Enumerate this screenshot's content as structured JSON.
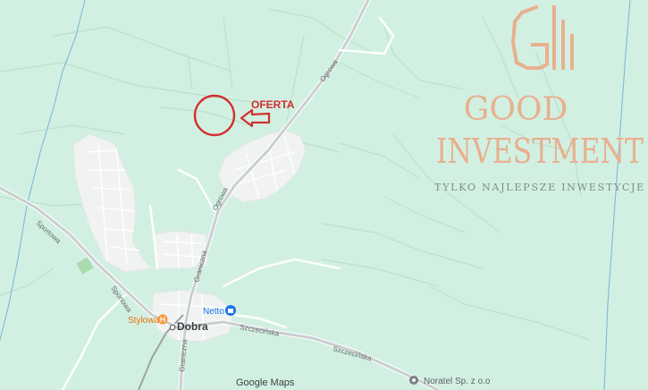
{
  "marker": {
    "label": "OFERTA",
    "color": "#d32f2f"
  },
  "brand": {
    "line1": "GOOD",
    "line2": "INVESTMENT",
    "tagline": "TYLKO NAJLEPSZE INWESTYCJE",
    "color": "#e8b08e",
    "logo_icon": "building-bars-logo-icon"
  },
  "places": {
    "town": "Dobra",
    "netto": "Netto",
    "stylowa": "Stylowa",
    "noratel": "Noratel Sp. z o.o"
  },
  "roads": {
    "ogrowa_north": "Ogrowa",
    "ogrowa_mid": "Ogrowa",
    "graniczna_north": "Graniczna",
    "graniczna_south": "Graniczna",
    "sportowa_north": "Sportowa",
    "sportowa_south": "Sportowa",
    "szczecinska_west": "Szczecińska",
    "szczecinska_east": "Szczecińska"
  },
  "attribution": "Google Maps",
  "colors": {
    "land": "#d2f0e2",
    "built_up": "#f1f3f2",
    "road_main": "#c8cdd0",
    "road_minor": "#b7ddc8",
    "railway": "#8f9a96",
    "poi_food": "#f59a3c",
    "poi_shop": "#1a73e8"
  }
}
